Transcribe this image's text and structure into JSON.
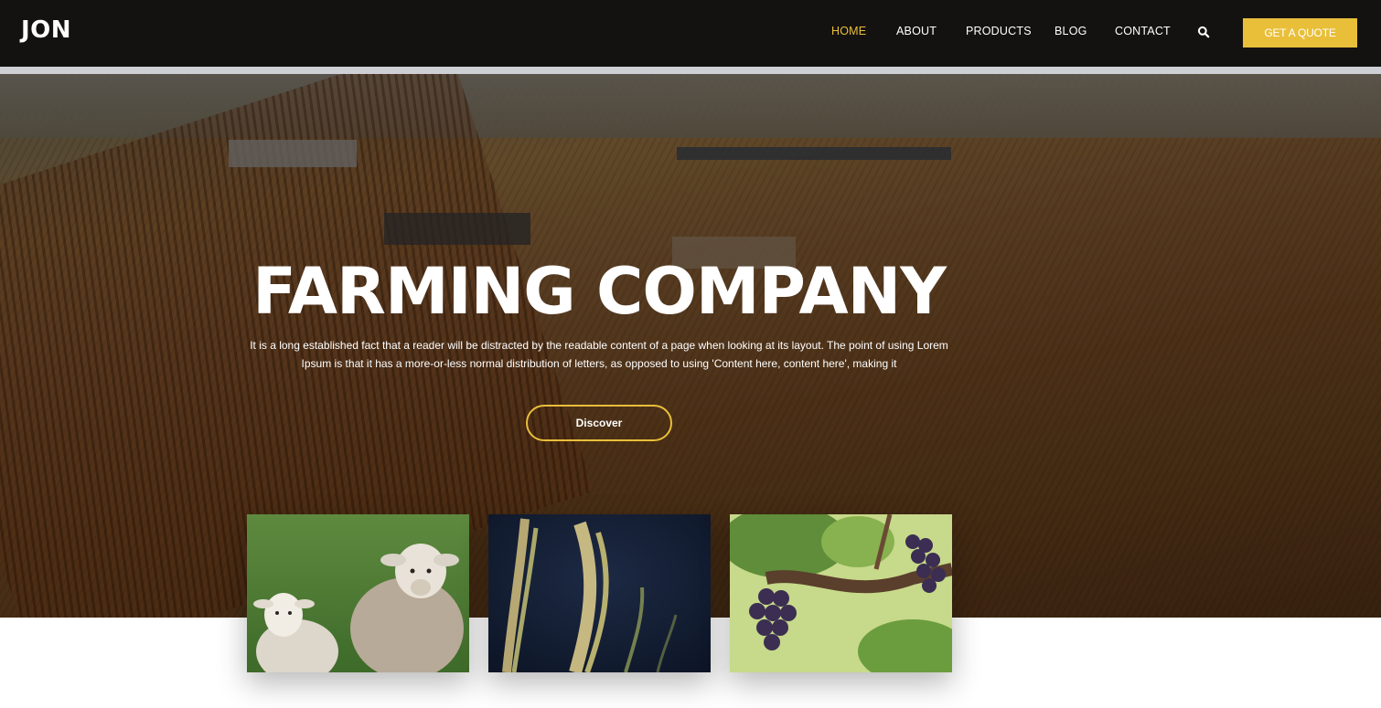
{
  "header": {
    "logo": "JON",
    "nav": [
      {
        "label": "HOME",
        "active": true
      },
      {
        "label": "ABOUT",
        "active": false
      },
      {
        "label": "PRODUCTS",
        "active": false
      },
      {
        "label": "BLOG",
        "active": false
      },
      {
        "label": "CONTACT",
        "active": false
      }
    ],
    "search_icon": "search-icon",
    "quote_button": "GET A QUOTE"
  },
  "hero": {
    "title": "FARMING COMPANY",
    "text": "It is a long established fact that a reader will be distracted by the readable content of a page when looking at its layout. The point of using Lorem Ipsum is that it has a more-or-less normal distribution of letters, as opposed to using 'Content here, content here', making it",
    "discover_button": "Discover"
  },
  "cards": [
    {
      "name": "sheep-image"
    },
    {
      "name": "wheat-image"
    },
    {
      "name": "grapes-image"
    }
  ],
  "colors": {
    "accent": "#e9bf3a",
    "header_bg": "#141210",
    "white": "#ffffff"
  }
}
